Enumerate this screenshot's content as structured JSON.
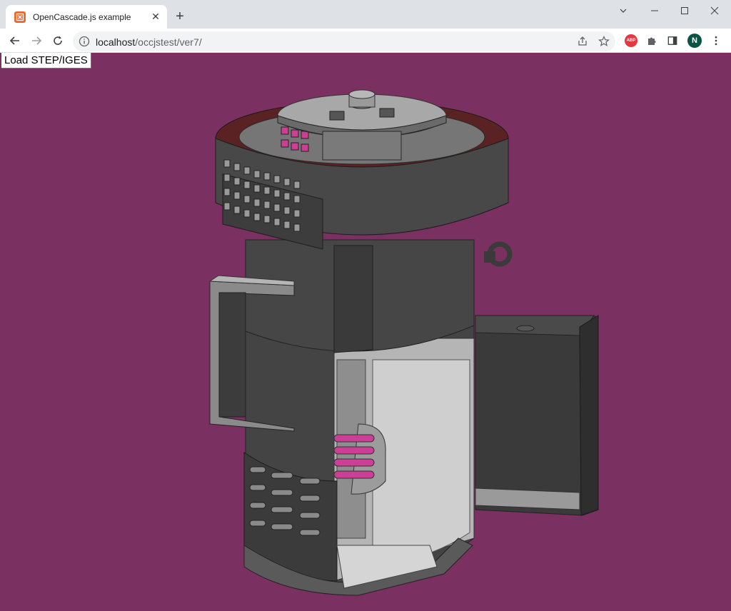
{
  "browser": {
    "tab": {
      "title": "OpenCascade.js example",
      "close": "✕"
    },
    "new_tab": "+",
    "address": {
      "host": "localhost",
      "path": "/occjstest/ver7/"
    },
    "profile_initial": "N",
    "abp_label": "ABP"
  },
  "page": {
    "load_button": "Load STEP/IGES",
    "background_color": "#7a3061",
    "model_color": "#3f3f3f"
  },
  "icons": [
    "app-favicon-icon",
    "back-icon",
    "forward-icon",
    "reload-icon",
    "info-icon",
    "share-icon",
    "star-icon",
    "adblock-icon",
    "puzzle-icon",
    "sidepanel-icon",
    "profile-avatar",
    "kebab-menu-icon",
    "chevron-down-icon",
    "minimize-icon",
    "maximize-icon",
    "close-window-icon"
  ]
}
